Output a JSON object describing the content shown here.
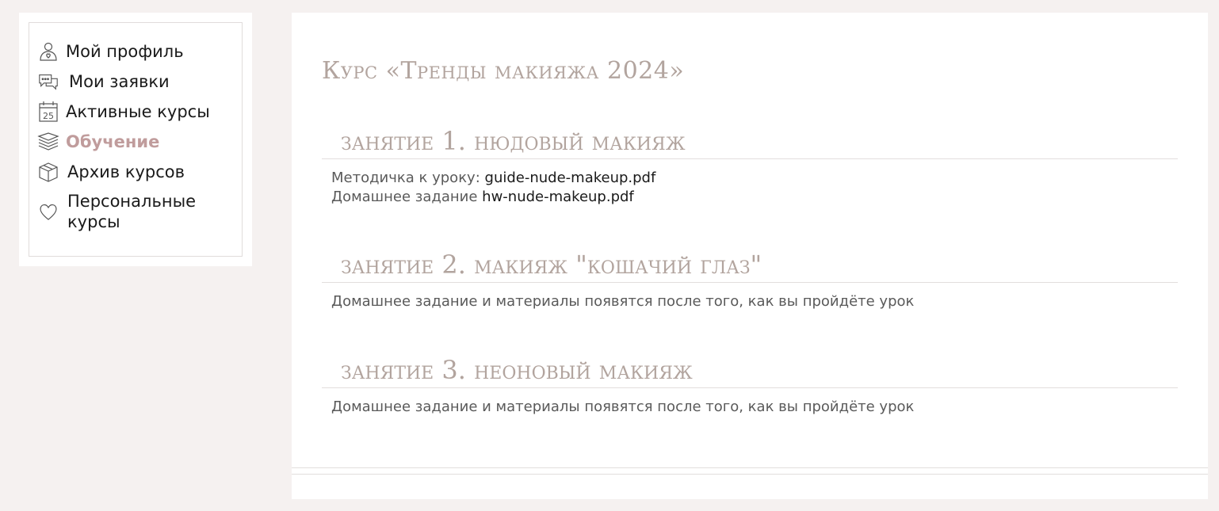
{
  "sidebar": {
    "items": [
      {
        "label": "Мой профиль",
        "icon": "user-heart-icon",
        "active": false
      },
      {
        "label": "Мои заявки",
        "icon": "chat-bubbles-icon",
        "active": false
      },
      {
        "label": "Активные курсы",
        "icon": "calendar-icon",
        "active": false
      },
      {
        "label": "Обучение",
        "icon": "books-stack-icon",
        "active": true
      },
      {
        "label": "Архив курсов",
        "icon": "box-icon",
        "active": false
      },
      {
        "label": "Персональные курсы",
        "icon": "heart-icon",
        "active": false
      }
    ],
    "calendar_number": "25"
  },
  "main": {
    "course_title": "Курс «Тренды макияжа 2024»",
    "lessons": [
      {
        "title": "Занятие 1. Нюдовый макияж",
        "guide_label": "Методичка к уроку:",
        "guide_link": "guide-nude-makeup.pdf",
        "hw_label": "Домашнее задание",
        "hw_link": "hw-nude-makeup.pdf"
      },
      {
        "title": "Занятие 2. Макияж \"кошачий глаз\"",
        "note": "Домашнее задание и материалы появятся после того, как вы пройдёте урок"
      },
      {
        "title": "Занятие 3. Неоновый макияж",
        "note": "Домашнее задание и материалы появятся после того, как вы пройдёте урок"
      }
    ]
  },
  "colors": {
    "accent": "#c09c9c",
    "heading": "#b2a49e",
    "background": "#f5f1f0"
  }
}
